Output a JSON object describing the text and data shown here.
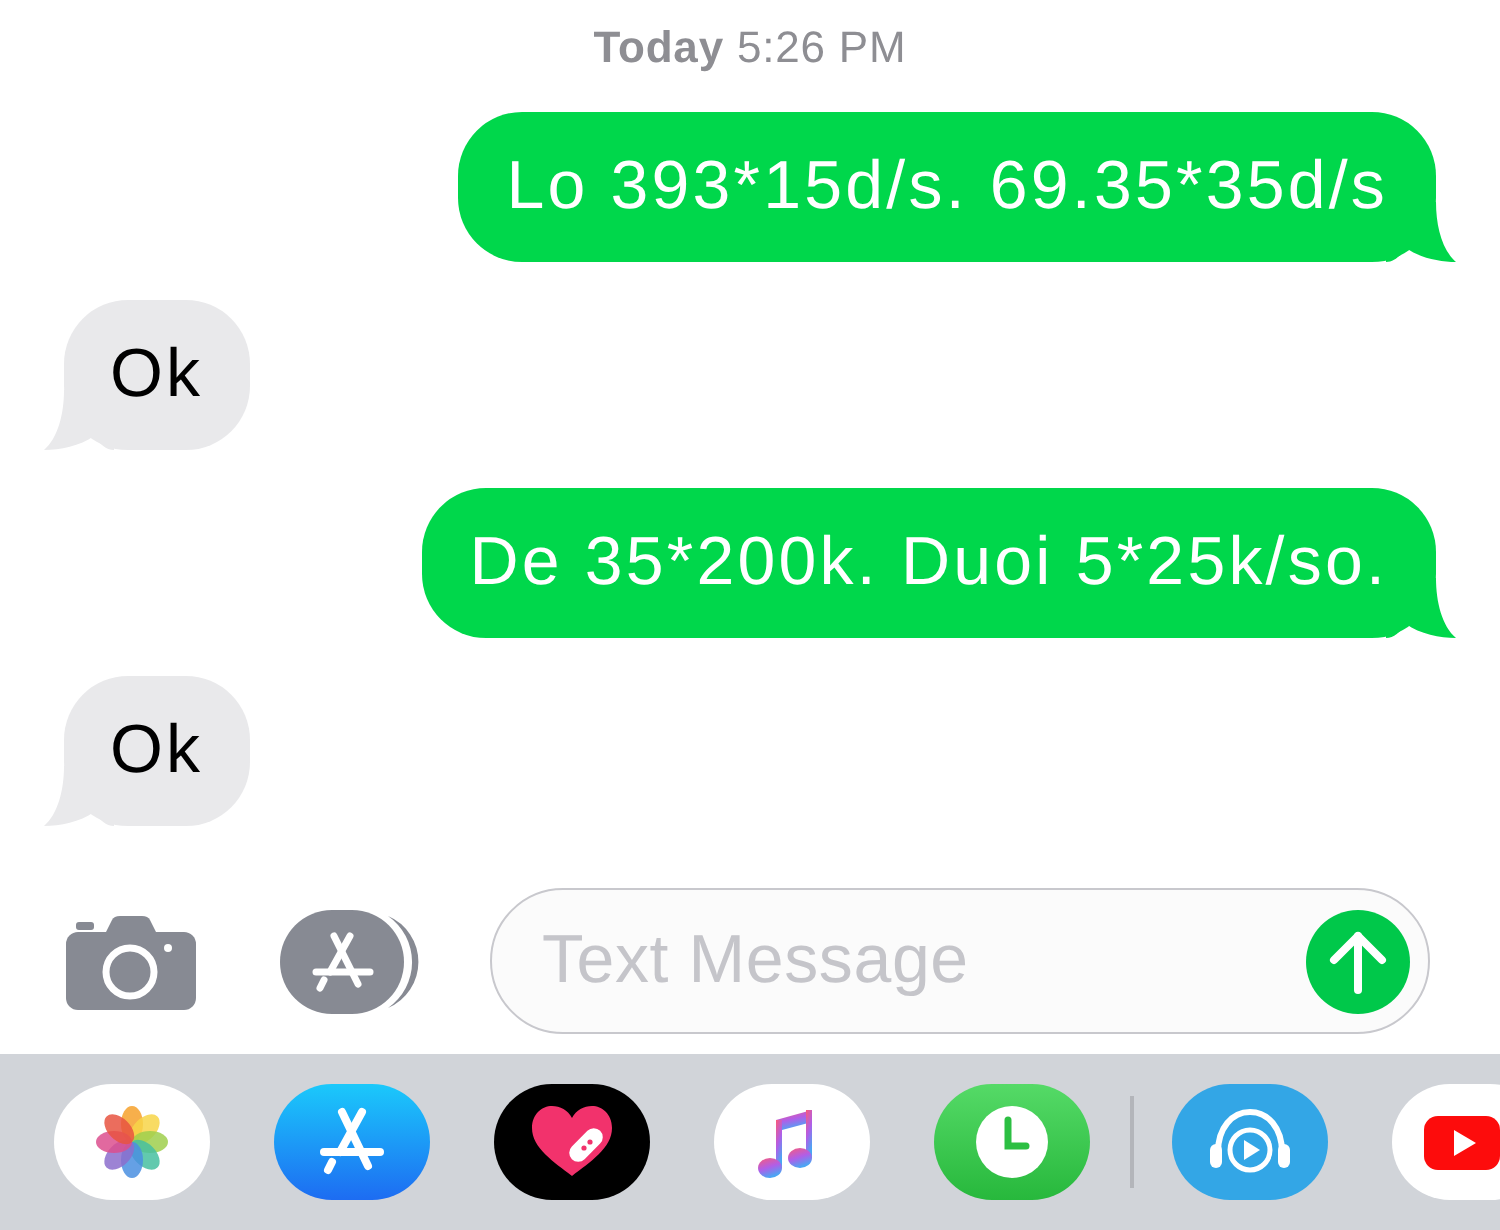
{
  "timestamp": "**Today** 5:26 PM",
  "messages": [
    {
      "kind": "sent",
      "text": "Lo 393*15d/s. 69.35*35d/s"
    },
    {
      "kind": "received",
      "text": "Ok"
    },
    {
      "kind": "sent",
      "text": "De 35*200k. Duoi 5*25k/so."
    },
    {
      "kind": "received",
      "text": "Ok"
    }
  ],
  "composer": {
    "placeholder": "Text Message"
  }
}
